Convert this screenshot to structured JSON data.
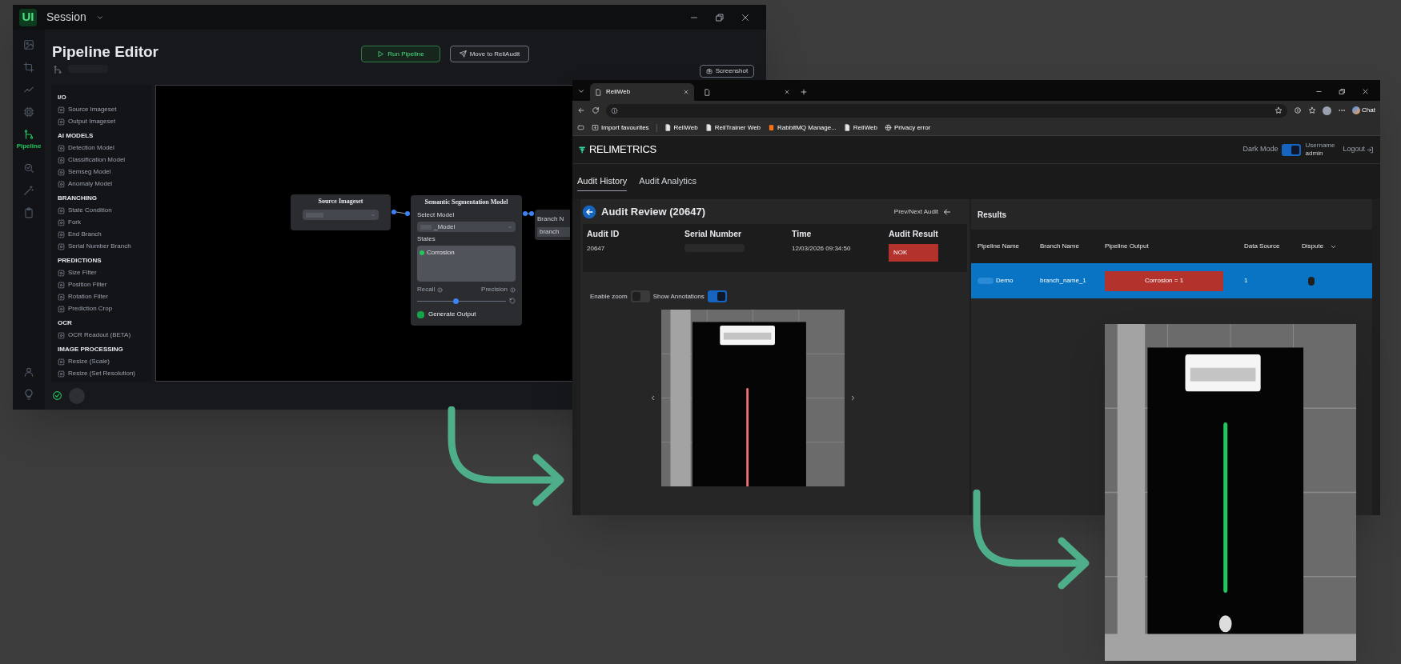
{
  "pipeline_window": {
    "app_logo": "UI",
    "title": "Session",
    "nav": [
      {
        "kind": "image",
        "selected": false
      },
      {
        "kind": "crop",
        "selected": false
      },
      {
        "kind": "trend",
        "selected": false
      },
      {
        "kind": "chip",
        "selected": false
      },
      {
        "kind": "branch",
        "label": "Pipeline",
        "selected": true
      },
      {
        "kind": "search",
        "selected": false
      },
      {
        "kind": "wand",
        "selected": false
      },
      {
        "kind": "clipboard",
        "selected": false
      },
      {
        "kind": "user",
        "selected": false
      },
      {
        "kind": "bulb",
        "selected": false
      }
    ],
    "heading": "Pipeline Editor",
    "buttons": [
      {
        "label": "Run Pipeline",
        "kind": "play"
      },
      {
        "label": "Move to ReliAudit",
        "kind": "send"
      }
    ],
    "screenshot_button": "Screenshot",
    "palette": [
      {
        "heading": "I/O",
        "items": [
          "Source Imageset",
          "Output Imageset"
        ]
      },
      {
        "heading": "AI MODELS",
        "items": [
          "Detection Model",
          "Classification Model",
          "Semseg Model",
          "Anomaly Model"
        ]
      },
      {
        "heading": "BRANCHING",
        "items": [
          "State Condition",
          "Fork",
          "End Branch",
          "Serial Number Branch"
        ]
      },
      {
        "heading": "PREDICTIONS",
        "items": [
          "Size Filter",
          "Position Filter",
          "Rotation Filter",
          "Prediction Crop"
        ]
      },
      {
        "heading": "OCR",
        "items": [
          "OCR Readout (BETA)"
        ]
      },
      {
        "heading": "IMAGE PROCESSING",
        "items": [
          "Resize (Scale)",
          "Resize (Set Resolution)"
        ]
      }
    ],
    "source_node": {
      "title": "Source Imageset"
    },
    "semseg_node": {
      "title": "Semantic Segmentation Model",
      "select_label": "Select Model",
      "model": "_Model",
      "states_label": "States",
      "states": [
        {
          "name": "Corrosion",
          "color": "#22c55e"
        }
      ],
      "recall_label": "Recall",
      "precision_label": "Precision",
      "threshold": {
        "level": 0.43
      },
      "generate_output": {
        "label": "Generate Output",
        "checked": true
      }
    },
    "branch_node": {
      "label": "Branch N",
      "value": "branch"
    }
  },
  "browser": {
    "tabs": [
      {
        "title": "ReliWeb",
        "selected": true
      },
      {
        "selected": false
      }
    ],
    "bookmarks": [
      {
        "label": "Import favourites",
        "kind": "import"
      },
      {
        "label": "ReliWeb",
        "kind": "page"
      },
      {
        "label": "ReliTrainer Web",
        "kind": "page"
      },
      {
        "label": "RabbitMQ Manage...",
        "kind": "rabbit"
      },
      {
        "label": "ReliWeb",
        "kind": "page"
      },
      {
        "label": "Privacy error",
        "kind": "globe"
      }
    ],
    "chat_label": "Chat",
    "brand": "RELIMETRICS",
    "dark_mode": {
      "label": "Dark Mode",
      "on": true
    },
    "user": {
      "caption": "Username",
      "name": "admin"
    },
    "logout": "Logout",
    "app_tabs": [
      {
        "label": "Audit History",
        "selected": true
      },
      {
        "label": "Audit Analytics",
        "selected": false
      }
    ],
    "review": {
      "title": "Audit Review (20647)",
      "prev_next": "Prev/Next Audit",
      "fields": [
        {
          "label": "Audit ID",
          "kind": "text",
          "value": "20647"
        },
        {
          "label": "Serial Number",
          "kind": "redacted"
        },
        {
          "label": "Time",
          "kind": "text",
          "value": "12/03/2026 09:34:50"
        },
        {
          "label": "Audit Result",
          "kind": "badge",
          "value": "NOK"
        }
      ],
      "toggles": [
        {
          "label": "Enable zoom",
          "on": false
        },
        {
          "label": "Show Annotations",
          "on": true
        }
      ]
    },
    "results": {
      "title": "Results",
      "columns": [
        "Pipeline Name",
        "Branch Name",
        "Pipeline Output",
        "Data Source",
        "Dispute"
      ],
      "rows": [
        {
          "pipeline_name": "Demo",
          "branch_name": "branch_name_1",
          "pipeline_output": "Corrosion = 1",
          "data_source": "1",
          "dispute": false,
          "selected": true
        }
      ]
    }
  }
}
